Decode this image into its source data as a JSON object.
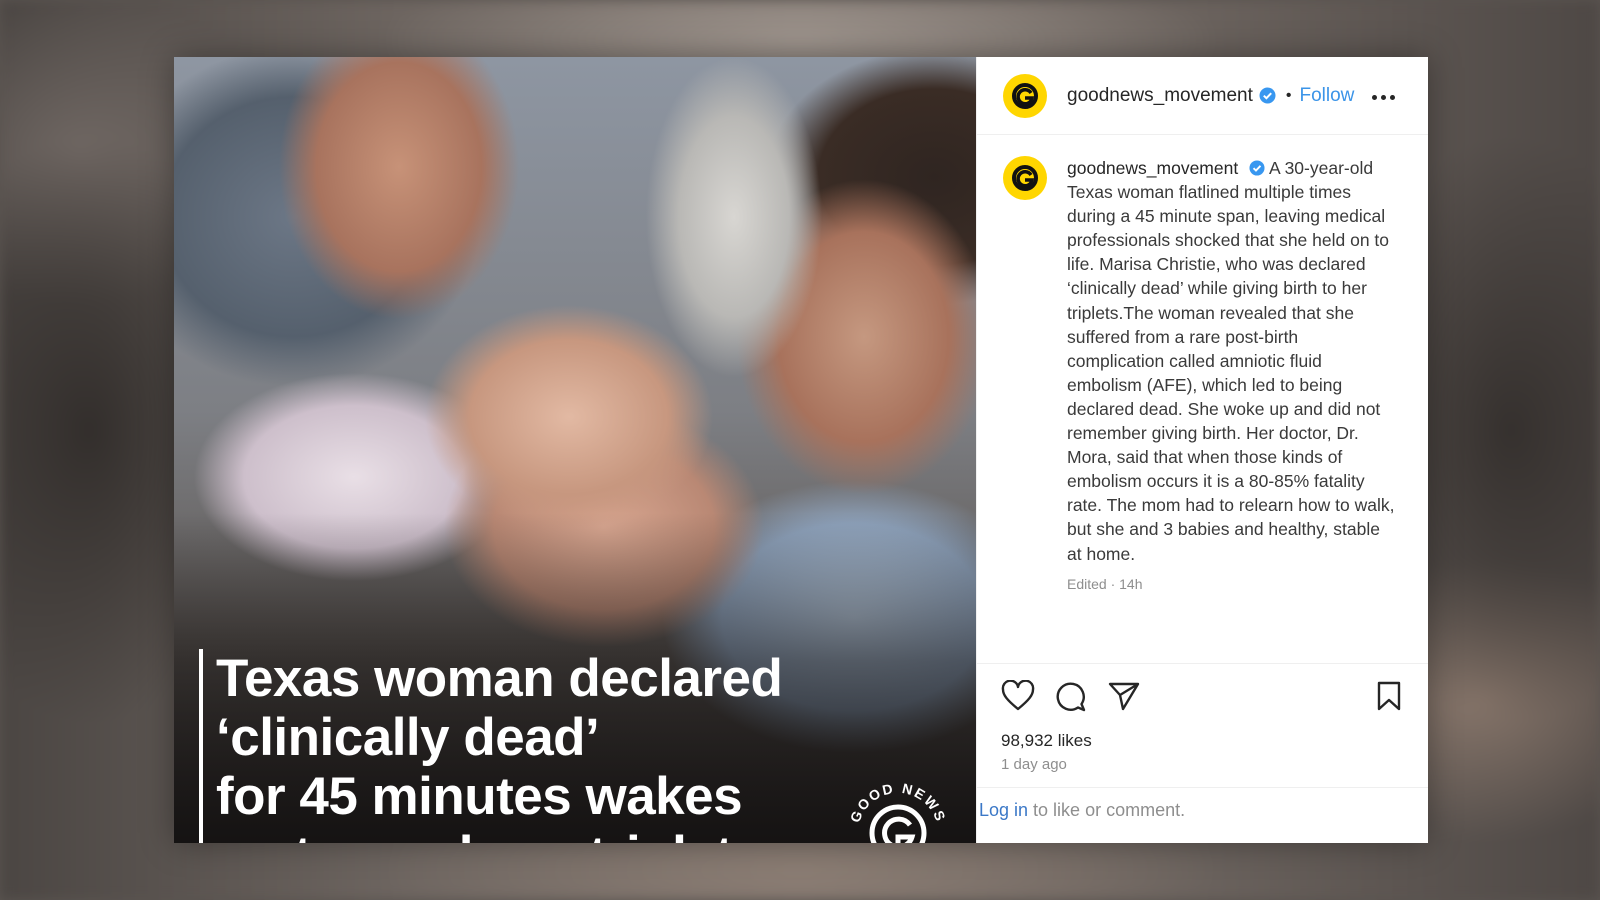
{
  "post": {
    "headline": {
      "line1": "Texas woman declared",
      "line2": "‘clinically dead’",
      "line3": "for 45 minutes wakes",
      "line4": "up to newborn triplets"
    },
    "watermark_logo_text": "GOOD NEWS MOVEMENT"
  },
  "header": {
    "username": "goodnews_movement",
    "separator": "•",
    "follow_label": "Follow",
    "more_icon": "more-options-icon"
  },
  "caption": {
    "username": "goodnews_movement",
    "text": "A 30-year-old Texas woman flatlined multiple times during a 45 minute span, leaving medical professionals shocked that she held on to life. Marisa Christie, who was declared ‘clinically dead’ while giving birth to her triplets.The woman revealed that she suffered from a rare post-birth complication called amniotic fluid embolism (AFE), which led to being declared dead. She woke up and did not remember giving birth. Her doctor, Dr. Mora, said that when those kinds of embolism occurs it is a 80-85% fatality rate. The mom had to relearn how to walk, but she and 3 babies and healthy, stable at home.",
    "edited": "Edited · 14h"
  },
  "actions": {
    "like_icon": "heart-icon",
    "comment_icon": "comment-icon",
    "share_icon": "share-icon",
    "save_icon": "bookmark-icon"
  },
  "stats": {
    "likes": "98,932 likes",
    "posted": "1 day ago"
  },
  "footer": {
    "login_link": "Log in",
    "login_rest": " to like or comment."
  },
  "colors": {
    "brand_yellow": "#ffd600",
    "link_blue": "#3b94e8",
    "verified_blue": "#3897f0"
  }
}
